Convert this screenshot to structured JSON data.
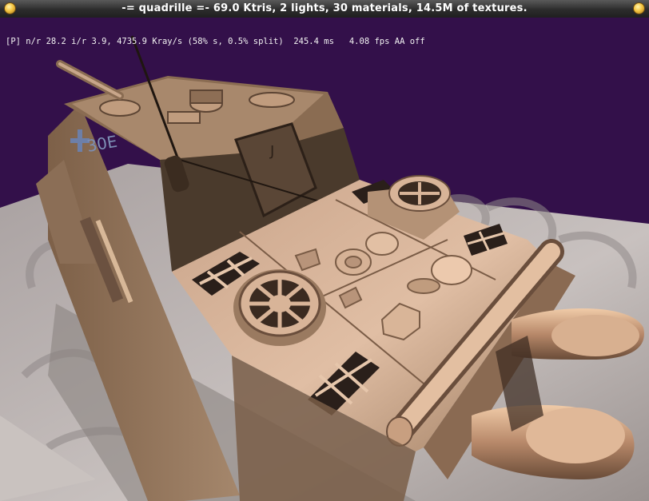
{
  "window": {
    "title": "-= quadrille =-  69.0 Ktris, 2 lights, 30 materials, 14.5M of textures.",
    "menu_button_icon": "window-menu-icon",
    "close_button_icon": "window-close-icon"
  },
  "overlay": {
    "stats": "[P] n/r 28.2 i/r 3.9, 4735.9 Kray/s (58% s, 0.5% split)  245.4 ms   4.08 fps AA off"
  },
  "scene": {
    "background_color": "#33104a",
    "floor_color": "#b9b2b0",
    "model_color": "#b08a6a",
    "model": "tank destroyer (jagdtiger) rear view",
    "hull_marking": "30E"
  }
}
